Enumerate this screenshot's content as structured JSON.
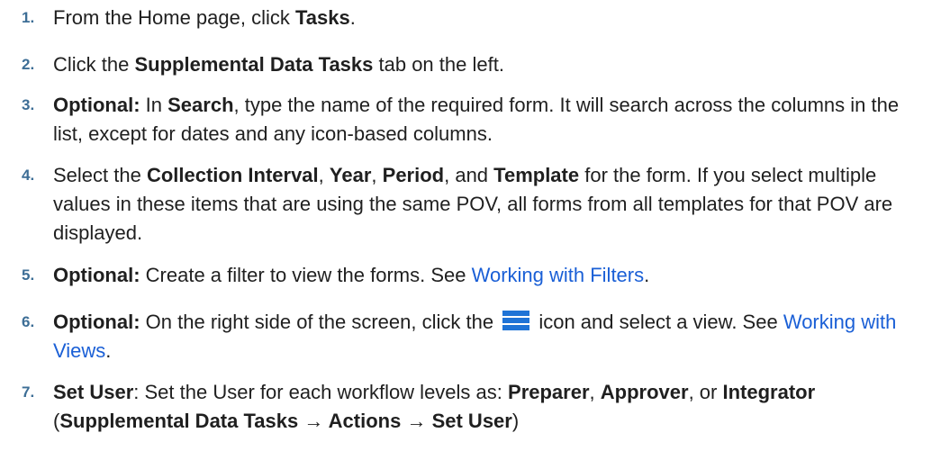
{
  "steps": [
    {
      "num": "1.",
      "t1": "From the Home page, click ",
      "b1": "Tasks",
      "t2": "."
    },
    {
      "num": "2.",
      "t1": "Click the ",
      "b1": "Supplemental Data Tasks",
      "t2": " tab on the left."
    },
    {
      "num": "3.",
      "b1": "Optional:",
      "t1": " In ",
      "b2": "Search",
      "t2": ", type the name of the required form. It will search across the columns in the list, except for dates and any icon-based columns."
    },
    {
      "num": "4.",
      "t1": "Select the ",
      "b1": "Collection Interval",
      "t2": ", ",
      "b2": "Year",
      "t3": ", ",
      "b3": "Period",
      "t4": ", and ",
      "b4": "Template",
      "t5": " for the form. If you select multiple values in these items that are using the same POV, all forms from all templates for that POV are displayed."
    },
    {
      "num": "5.",
      "b1": "Optional:",
      "t1": " Create a filter to view the forms. See ",
      "link": "Working with Filters",
      "t2": "."
    },
    {
      "num": "6.",
      "b1": "Optional:",
      "t1": " On the right side of the screen, click the ",
      "icon": "hamburger-menu-icon",
      "t2": " icon and select a view. See ",
      "link": "Working with Views",
      "t3": "."
    },
    {
      "num": "7.",
      "b1": "Set User",
      "t1": ": Set the User for each workflow levels as: ",
      "b2": "Preparer",
      "t2": ", ",
      "b3": "Approver",
      "t3": ", or ",
      "b4": "Integrator",
      "t4": " (",
      "b5": "Supplemental Data Tasks",
      "t5": " → ",
      "b6": "Actions",
      "t6": " → ",
      "b7": "Set User",
      "t7": ")"
    }
  ],
  "colors": {
    "step_number": "#3d6e96",
    "link": "#1a5fd6",
    "icon": "#1f73d6"
  }
}
